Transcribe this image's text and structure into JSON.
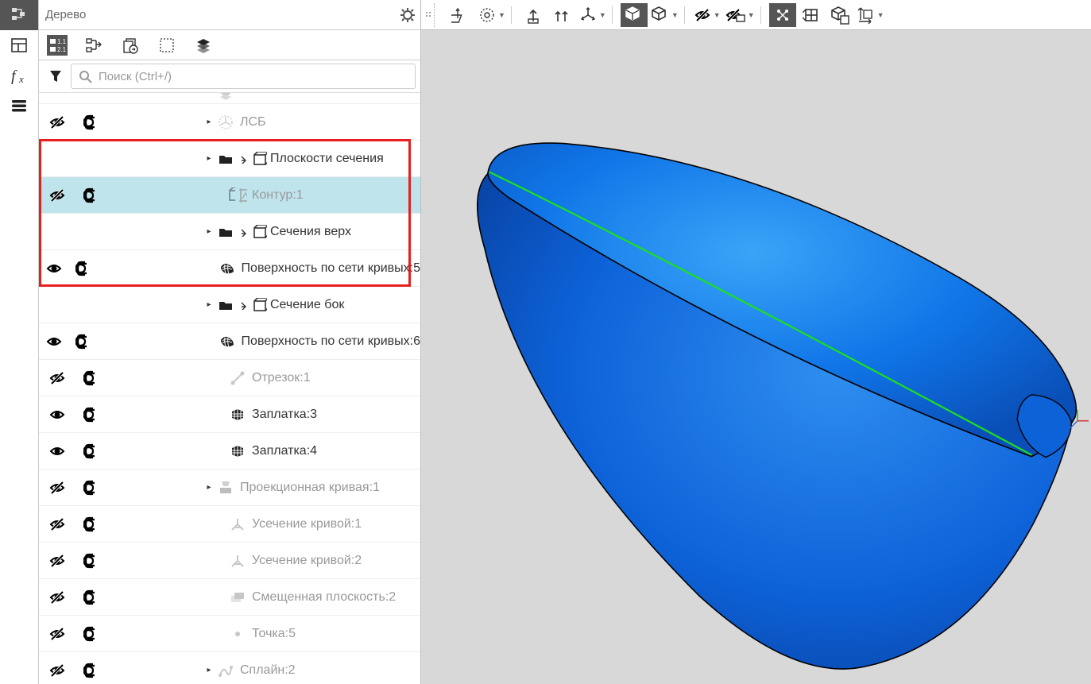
{
  "panel": {
    "title": "Дерево"
  },
  "search": {
    "placeholder": "Поиск (Ctrl+/)"
  },
  "tree": [
    {
      "vis": "",
      "inc": "",
      "indent": 120,
      "expand": "",
      "icon": "layers",
      "label": "",
      "dim": true,
      "sel": false,
      "partial": true
    },
    {
      "vis": "hidden",
      "inc": "in",
      "indent": 120,
      "expand": "▸",
      "icon": "lcs",
      "label": "ЛСБ",
      "dim": true,
      "sel": false
    },
    {
      "vis": "",
      "inc": "",
      "indent": 120,
      "expand": "▸",
      "icon": "folder",
      "label": "Плоскости сечения",
      "dim": false,
      "sel": false,
      "folder": true
    },
    {
      "vis": "hidden",
      "inc": "in",
      "indent": 135,
      "expand": "",
      "icon": "contour",
      "label": "Контур:1",
      "dim": true,
      "sel": true
    },
    {
      "vis": "",
      "inc": "",
      "indent": 120,
      "expand": "▸",
      "icon": "folder",
      "label": "Сечения верх",
      "dim": false,
      "sel": false,
      "folder": true
    },
    {
      "vis": "shown",
      "inc": "in",
      "indent": 135,
      "expand": "",
      "icon": "surf",
      "label": "Поверхность по сети кривых:5",
      "dim": false,
      "sel": false
    },
    {
      "vis": "",
      "inc": "",
      "indent": 120,
      "expand": "▸",
      "icon": "folder",
      "label": "Сечение бок",
      "dim": false,
      "sel": false,
      "folder": true
    },
    {
      "vis": "shown",
      "inc": "in",
      "indent": 135,
      "expand": "",
      "icon": "surf",
      "label": "Поверхность по сети кривых:6",
      "dim": false,
      "sel": false
    },
    {
      "vis": "hidden",
      "inc": "in",
      "indent": 135,
      "expand": "",
      "icon": "segment",
      "label": "Отрезок:1",
      "dim": true,
      "sel": false
    },
    {
      "vis": "shown",
      "inc": "in",
      "indent": 135,
      "expand": "",
      "icon": "patch",
      "label": "Заплатка:3",
      "dim": false,
      "sel": false
    },
    {
      "vis": "shown",
      "inc": "in",
      "indent": 135,
      "expand": "",
      "icon": "patch",
      "label": "Заплатка:4",
      "dim": false,
      "sel": false
    },
    {
      "vis": "hidden",
      "inc": "in",
      "indent": 120,
      "expand": "▸",
      "icon": "proj",
      "label": "Проекционная кривая:1",
      "dim": true,
      "sel": false
    },
    {
      "vis": "hidden",
      "inc": "in",
      "indent": 135,
      "expand": "",
      "icon": "trim",
      "label": "Усечение кривой:1",
      "dim": true,
      "sel": false
    },
    {
      "vis": "hidden",
      "inc": "in",
      "indent": 135,
      "expand": "",
      "icon": "trim",
      "label": "Усечение кривой:2",
      "dim": true,
      "sel": false
    },
    {
      "vis": "hidden",
      "inc": "in",
      "indent": 135,
      "expand": "",
      "icon": "oplane",
      "label": "Смещенная плоскость:2",
      "dim": true,
      "sel": false
    },
    {
      "vis": "hidden",
      "inc": "in",
      "indent": 135,
      "expand": "",
      "icon": "point",
      "label": "Точка:5",
      "dim": true,
      "sel": false
    },
    {
      "vis": "hidden",
      "inc": "in",
      "indent": 120,
      "expand": "▸",
      "icon": "spline",
      "label": "Сплайн:2",
      "dim": true,
      "sel": false
    }
  ],
  "highlight": {
    "top_row": 2,
    "rows": 4
  },
  "icons": {
    "tree-active": "tree",
    "tree-panel": "panel",
    "fx": "fx",
    "stack": "stack",
    "t1": "tree-num",
    "t2": "tree-arrow",
    "t3": "tree-doc",
    "t4": "tree-sel",
    "t5": "tree-layers",
    "tb_lcs": "lcs",
    "tb_sel": "sel",
    "tb_up": "up",
    "tb_up2": "up2",
    "tb_axis": "axis",
    "tb_cube1": "cube-solid",
    "tb_cube2": "cube-wire",
    "tb_hide1": "eye-off",
    "tb_hide2": "eye-off2",
    "tb_g1": "g1",
    "tb_g2": "g2",
    "tb_g3": "g3",
    "tb_g4": "g4"
  }
}
